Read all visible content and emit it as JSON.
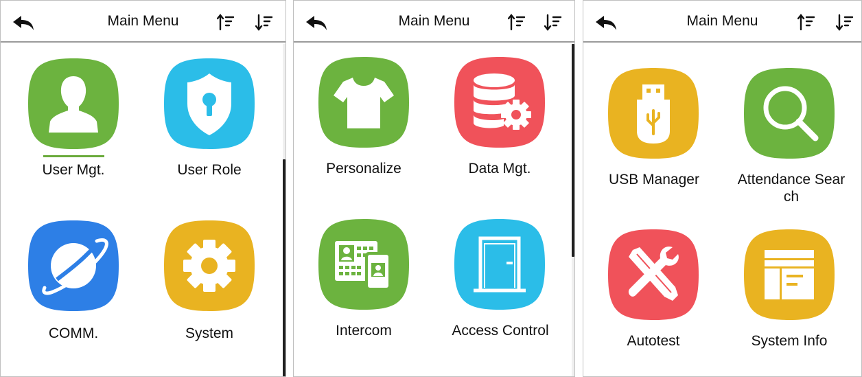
{
  "colors": {
    "green": "#6cb33f",
    "cyan": "#2bbde8",
    "blue": "#2d7fe6",
    "yellow": "#e9b321",
    "red": "#f0525a",
    "header_border": "#9a9a9a"
  },
  "panels": [
    {
      "title": "Main Menu",
      "back_icon": "back-arrow-icon",
      "sort_asc_icon": "sort-ascending-icon",
      "sort_desc_icon": "sort-descending-icon",
      "items": [
        {
          "label": "User Mgt.",
          "icon": "user-icon",
          "color": "#6cb33f",
          "selected": true
        },
        {
          "label": "User Role",
          "icon": "shield-keyhole-icon",
          "color": "#2bbde8"
        },
        {
          "label": "COMM.",
          "icon": "planet-icon",
          "color": "#2d7fe6"
        },
        {
          "label": "System",
          "icon": "gear-icon",
          "color": "#e9b321"
        }
      ]
    },
    {
      "title": "Main Menu",
      "back_icon": "back-arrow-icon",
      "sort_asc_icon": "sort-ascending-icon",
      "sort_desc_icon": "sort-descending-icon",
      "items": [
        {
          "label": "Personalize",
          "icon": "tshirt-icon",
          "color": "#6cb33f"
        },
        {
          "label": "Data Mgt.",
          "icon": "database-gear-icon",
          "color": "#f0525a"
        },
        {
          "label": "Intercom",
          "icon": "id-cards-icon",
          "color": "#6cb33f"
        },
        {
          "label": "Access Control",
          "icon": "door-icon",
          "color": "#2bbde8"
        }
      ]
    },
    {
      "title": "Main Menu",
      "back_icon": "back-arrow-icon",
      "sort_asc_icon": "sort-ascending-icon",
      "sort_desc_icon": "sort-descending-icon",
      "items": [
        {
          "label": "USB Manager",
          "icon": "usb-drive-icon",
          "color": "#e9b321"
        },
        {
          "label": "Attendance Sear",
          "label_line2": "ch",
          "icon": "magnifier-icon",
          "color": "#6cb33f"
        },
        {
          "label": "Autotest",
          "icon": "tools-icon",
          "color": "#f0525a"
        },
        {
          "label": "System Info",
          "icon": "system-info-icon",
          "color": "#e9b321"
        }
      ]
    }
  ]
}
